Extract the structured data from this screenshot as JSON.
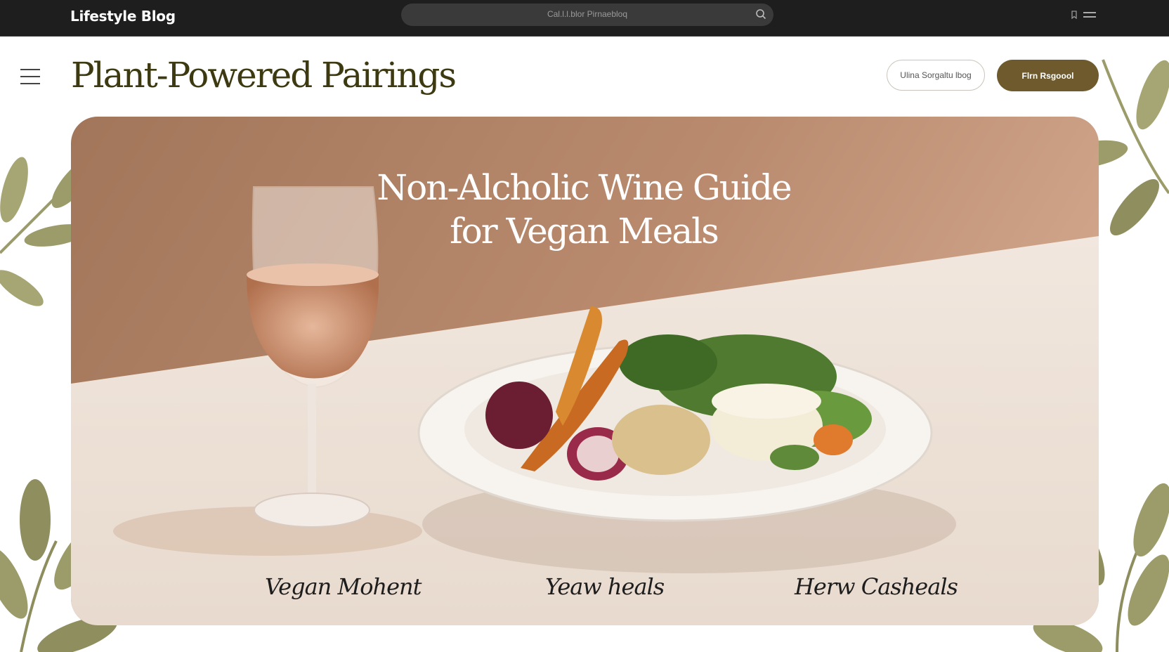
{
  "topbar": {
    "brand": "Lifestyle Blog",
    "search_placeholder": "Cal.l.l.blor Pirnaebloq"
  },
  "header": {
    "title": "Plant-Powered Pairings",
    "outline_button": "Ulina Sorgaltu lbog",
    "filled_button": "Flrn Rsgoool"
  },
  "hero": {
    "title_line1": "Non-Alcholic Wine Guide",
    "title_line2": "for Vegan Meals",
    "captions": [
      "Vegan Mohent",
      "Yeaw heals",
      "Herw Casheals"
    ]
  },
  "colors": {
    "topbar": "#1e1e1e",
    "title": "#3d3a12",
    "accent_button": "#6e5a2c",
    "hero_wall": "#b98a6e",
    "hero_table": "#efe4da",
    "leaf": "#9c9b6a"
  },
  "icons": [
    "search-icon",
    "bookmark-icon",
    "menu-icon",
    "hamburger-icon",
    "leaf-icon"
  ]
}
